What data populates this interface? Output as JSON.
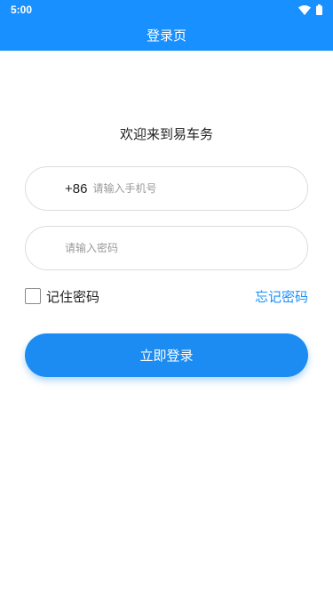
{
  "status_bar": {
    "time": "5:00",
    "icons": [
      "wifi-icon",
      "battery-icon"
    ]
  },
  "header": {
    "title": "登录页"
  },
  "welcome_text": "欢迎来到易车务",
  "phone_field": {
    "prefix": "+86",
    "placeholder": "请输入手机号",
    "value": ""
  },
  "password_field": {
    "placeholder": "请输入密码",
    "value": ""
  },
  "remember": {
    "label": "记住密码",
    "checked": false
  },
  "forgot_link": "忘记密码",
  "login_button": "立即登录",
  "colors": {
    "primary": "#1890ff",
    "button": "#1c8cf2",
    "link": "#1890ff"
  }
}
